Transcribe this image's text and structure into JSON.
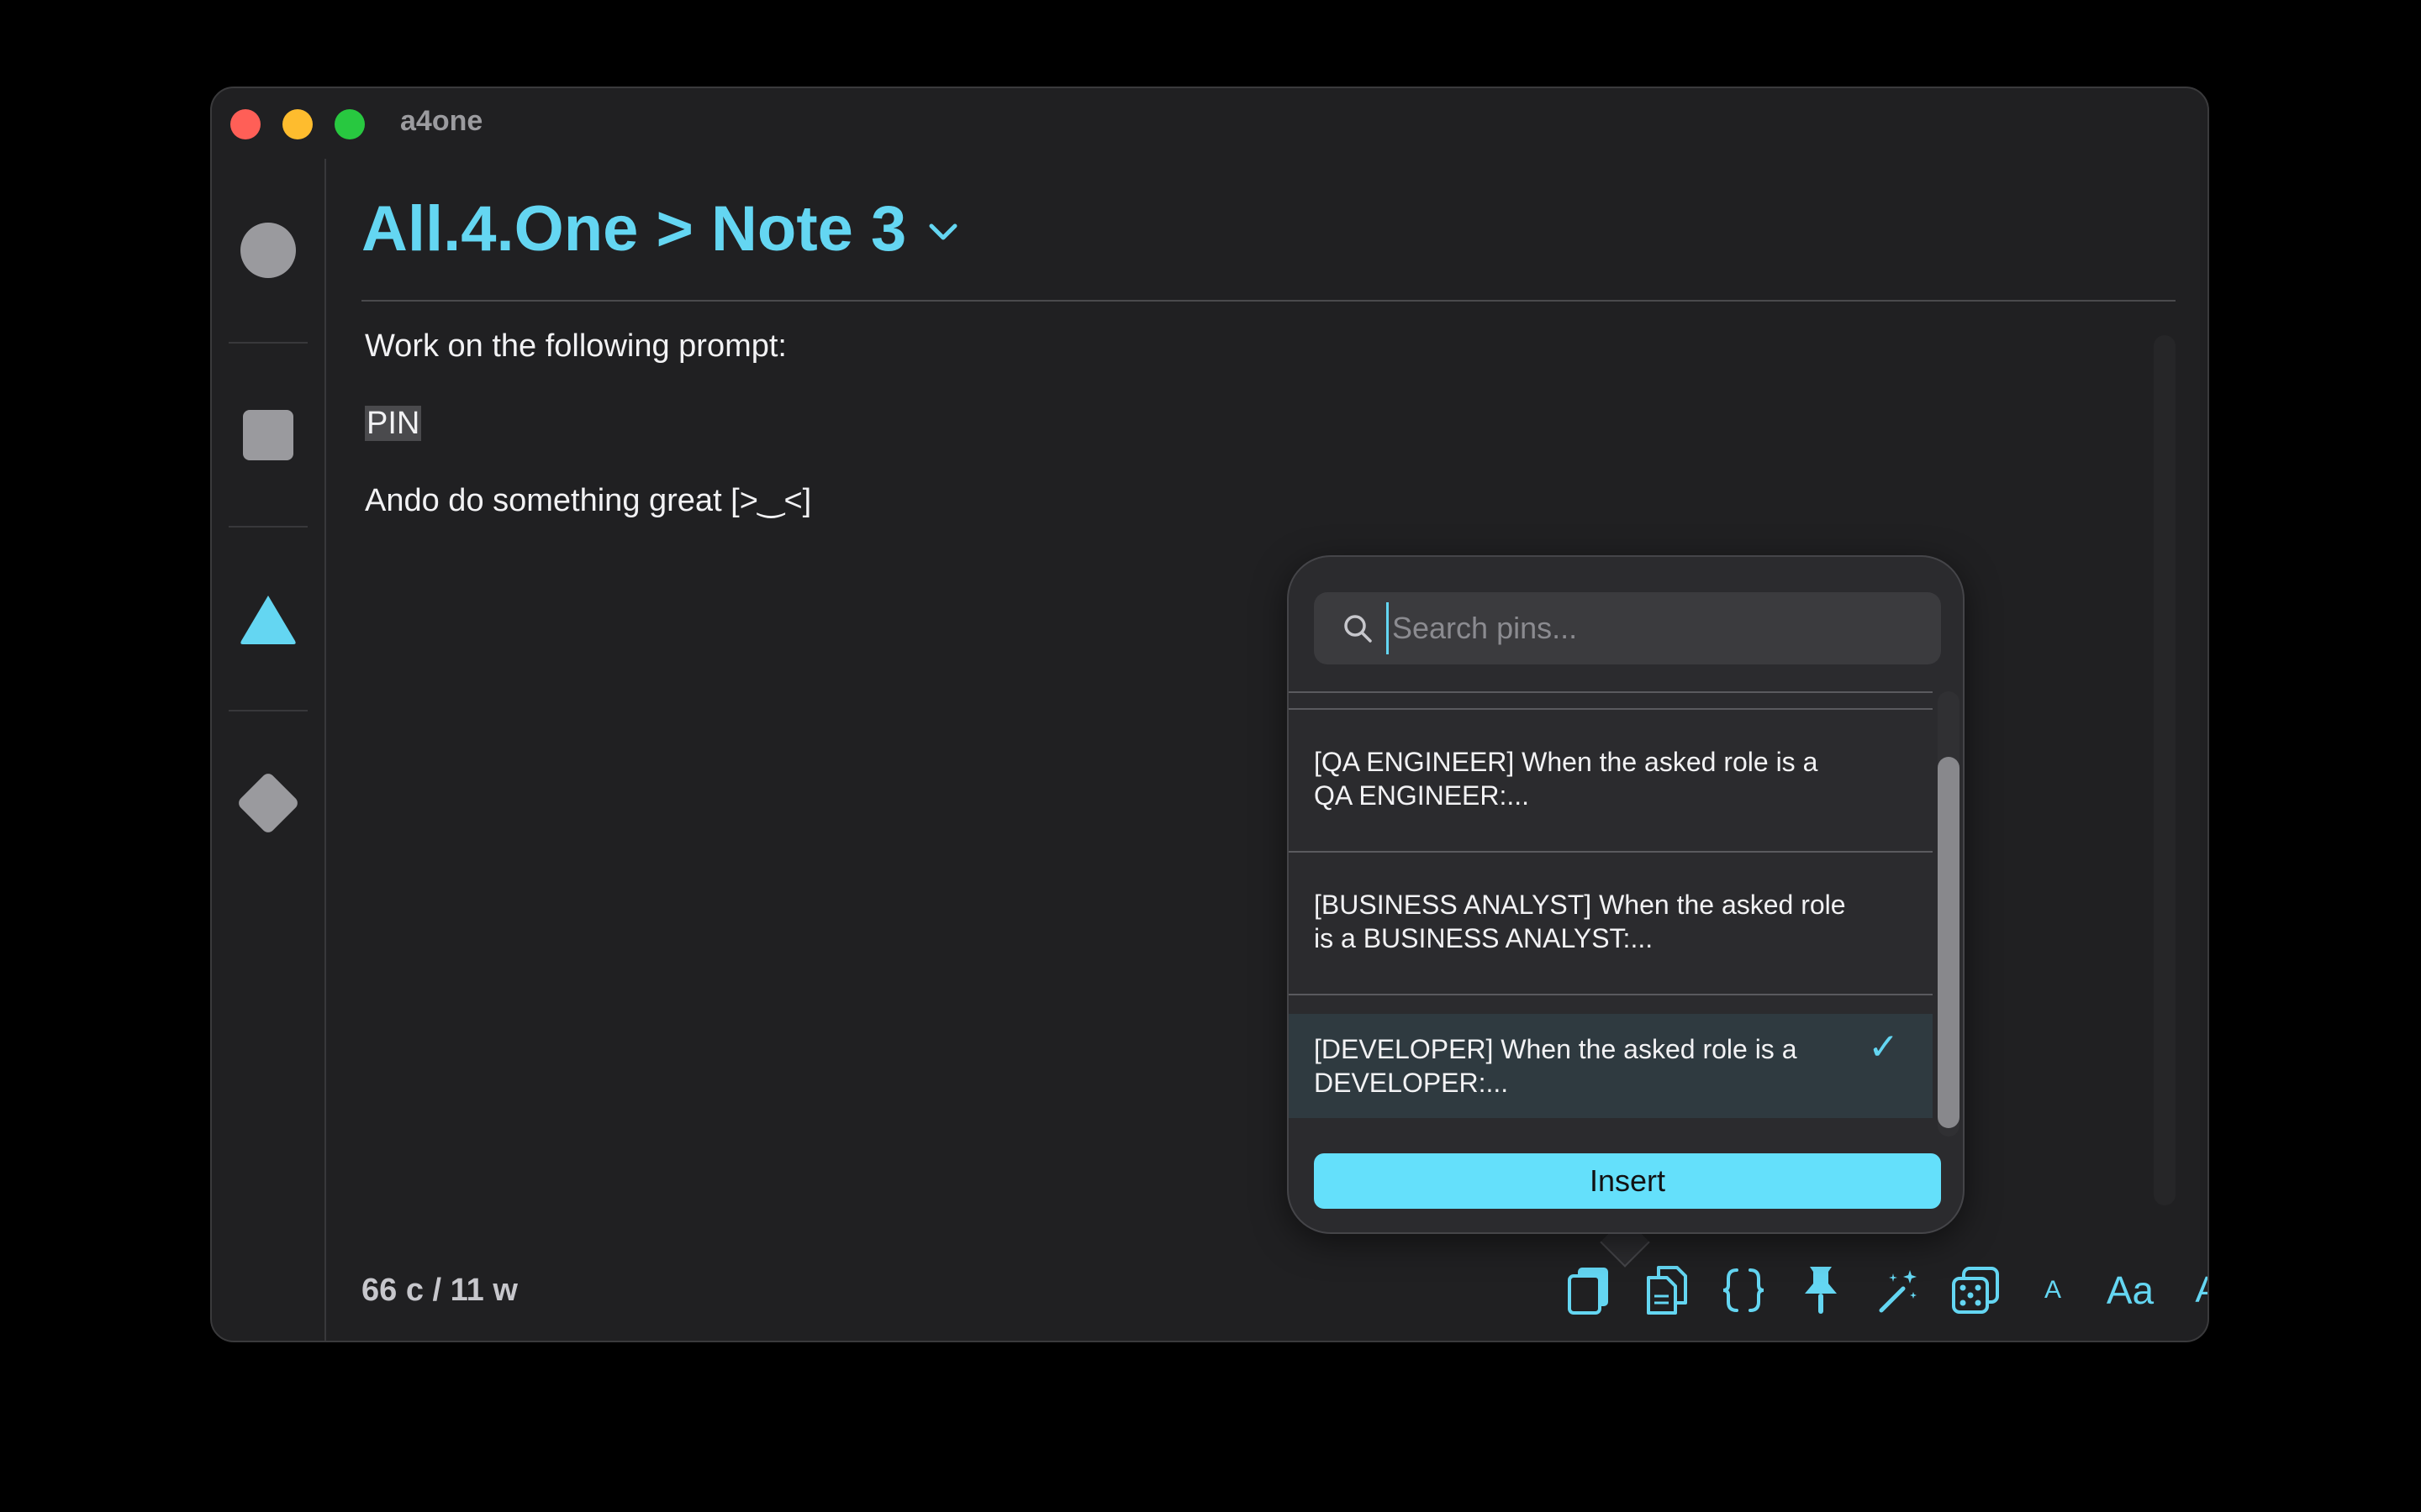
{
  "window": {
    "title": "a4one"
  },
  "header": {
    "breadcrumb": "All.4.One > Note 3"
  },
  "editor": {
    "line1": "Work on the following prompt:",
    "line2": "PIN",
    "line3": "Ando do something great [>‿<]"
  },
  "footer": {
    "count": "66 c / 11 w"
  },
  "toolbar": {
    "small_a": "A",
    "aa": "Aa",
    "large_a": "A"
  },
  "popover": {
    "search_placeholder": "Search pins...",
    "items": [
      {
        "text": "[QA ENGINEER] When the asked role is a QA ENGINEER:..."
      },
      {
        "text": "[BUSINESS ANALYST] When the asked role is a BUSINESS ANALYST:..."
      },
      {
        "text": "[DEVELOPER] When the asked role is a DEVELOPER:..."
      }
    ],
    "selected_index": 2,
    "insert_label": "Insert"
  },
  "colors": {
    "accent": "#64d6f2",
    "background": "#202022",
    "selected_row": "#2f3a40"
  }
}
